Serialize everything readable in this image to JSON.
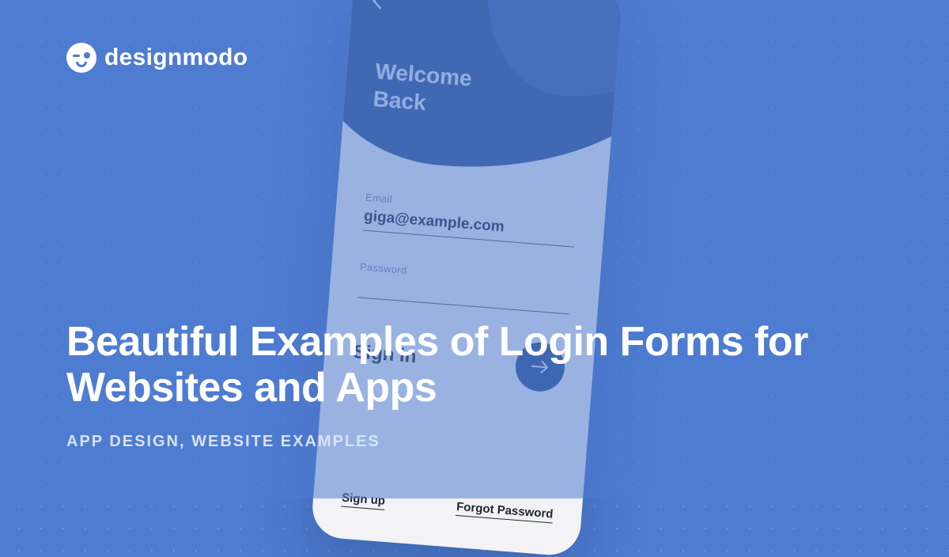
{
  "brand": {
    "name": "designmodo"
  },
  "headline": {
    "title": "Beautiful Examples of Login Forms for Websites and Apps",
    "tags": "APP DESIGN, WEBSITE EXAMPLES"
  },
  "mockup": {
    "welcome_line1": "Welcome",
    "welcome_line2": "Back",
    "email_label": "Email",
    "email_value": "giga@example.com",
    "password_label": "Password",
    "signin_label": "Sign in",
    "signup_link": "Sign up",
    "forgot_link": "Forgot Password"
  }
}
